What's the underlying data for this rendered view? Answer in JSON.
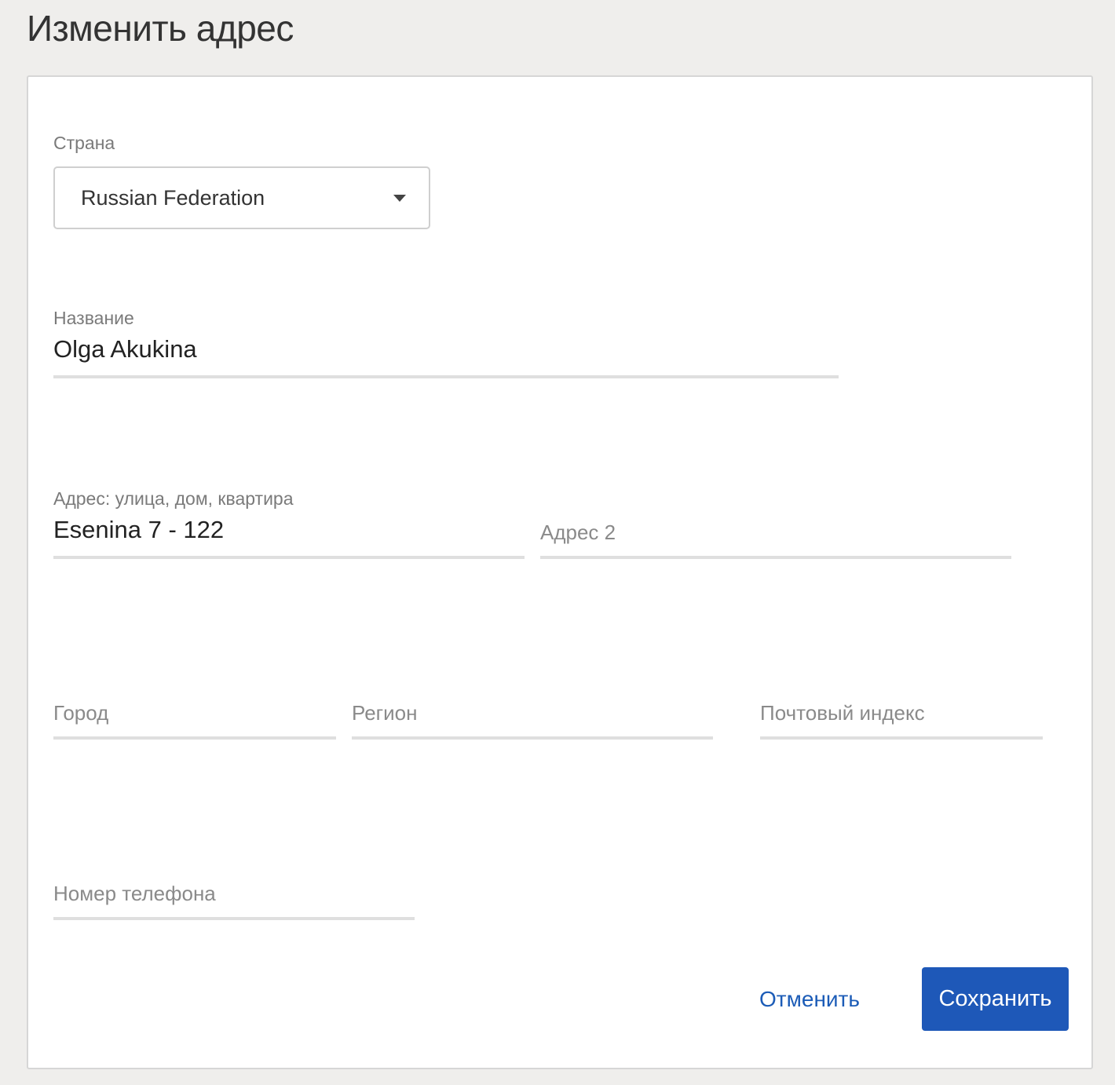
{
  "page": {
    "title": "Изменить адрес"
  },
  "form": {
    "country": {
      "label": "Страна",
      "value": "Russian Federation"
    },
    "name": {
      "label": "Название",
      "value": "Olga Akukina"
    },
    "address1": {
      "label": "Адрес: улица, дом, квартира",
      "value": "Esenina 7 - 122"
    },
    "address2": {
      "placeholder": "Адрес 2",
      "value": ""
    },
    "city": {
      "placeholder": "Город",
      "value": ""
    },
    "region": {
      "placeholder": "Регион",
      "value": ""
    },
    "postal_code": {
      "placeholder": "Почтовый индекс",
      "value": ""
    },
    "phone": {
      "placeholder": "Номер телефона",
      "value": ""
    }
  },
  "actions": {
    "cancel_label": "Отменить",
    "save_label": "Сохранить"
  },
  "colors": {
    "background": "#efeeec",
    "card": "#ffffff",
    "accent": "#1e58b8",
    "link": "#1c5cb7",
    "underline": "#dfdfdf"
  }
}
